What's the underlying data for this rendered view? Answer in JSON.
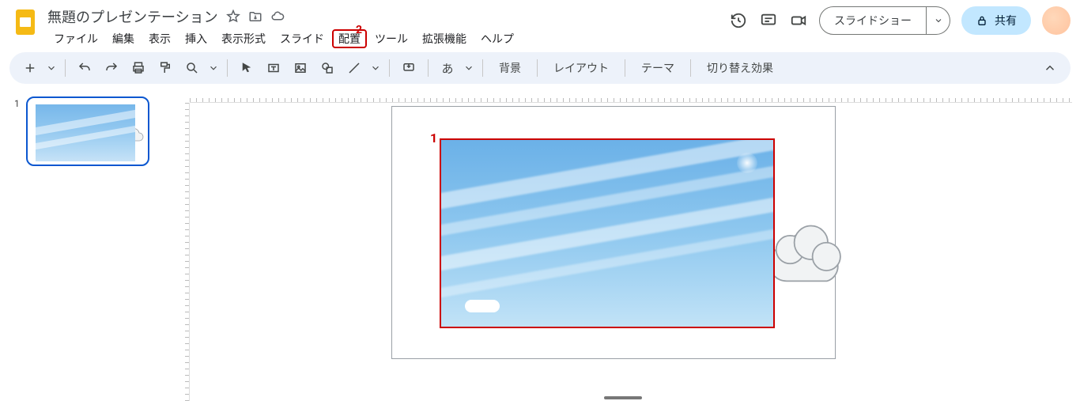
{
  "doc_title": "無題のプレゼンテーション",
  "menus": {
    "file": "ファイル",
    "edit": "編集",
    "view": "表示",
    "insert": "挿入",
    "format": "表示形式",
    "slide": "スライド",
    "arrange": "配置",
    "tools": "ツール",
    "extensions": "拡張機能",
    "help": "ヘルプ"
  },
  "annotations": {
    "menu_arrange_num": "2",
    "selection_num": "1"
  },
  "header_buttons": {
    "slideshow": "スライドショー",
    "share": "共有"
  },
  "toolbar_text": {
    "background": "背景",
    "layout": "レイアウト",
    "theme": "テーマ",
    "transition": "切り替え効果",
    "input_method": "あ"
  },
  "thumbnail": {
    "number": "1"
  }
}
